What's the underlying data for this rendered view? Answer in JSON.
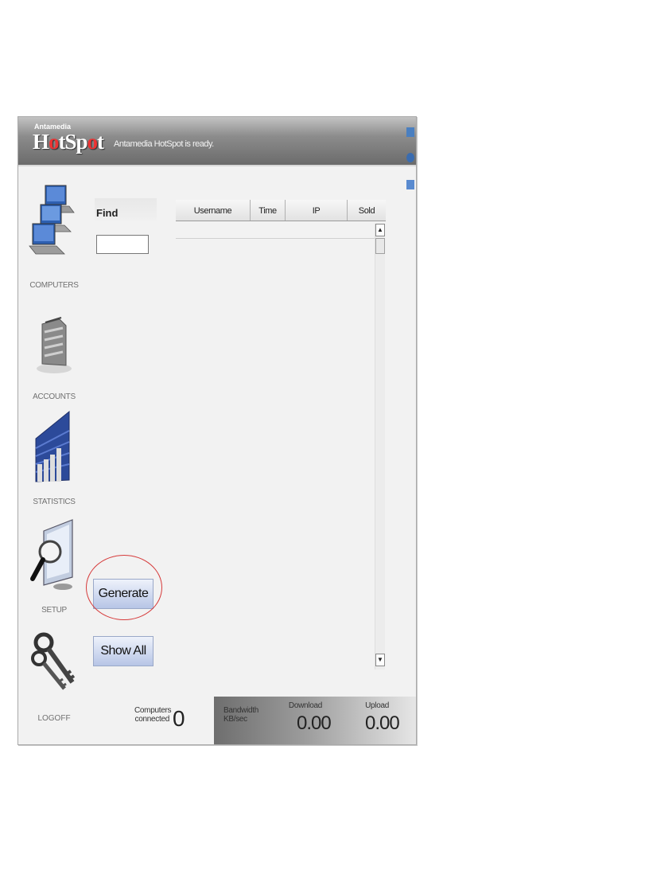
{
  "header": {
    "brand_small": "Antamedia",
    "brand_pre": "H",
    "brand_o1": "o",
    "brand_mid": "tSp",
    "brand_o2": "o",
    "brand_post": "t",
    "status": "Antamedia HotSpot is ready."
  },
  "nav": {
    "computers": "COMPUTERS",
    "accounts": "ACCOUNTS",
    "statistics": "STATISTICS",
    "setup": "SETUP",
    "logoff": "LOGOFF"
  },
  "find": {
    "label": "Find",
    "value": ""
  },
  "table": {
    "columns": [
      "Username",
      "Time",
      "IP",
      "Sold"
    ]
  },
  "buttons": {
    "generate": "Generate",
    "show_all": "Show All"
  },
  "footer": {
    "computers_line1": "Computers",
    "computers_line2": "connected",
    "computers_value": "0",
    "bandwidth_line1": "Bandwidth",
    "bandwidth_line2": "KB/sec",
    "download_label": "Download",
    "download_value": "0.00",
    "upload_label": "Upload",
    "upload_value": "0.00"
  },
  "colors": {
    "accent_ring": "#d63b3b",
    "button_blue": "#b7c5e6"
  }
}
